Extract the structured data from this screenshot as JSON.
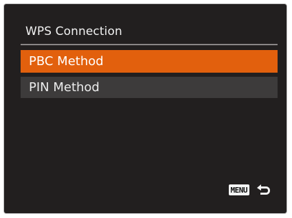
{
  "dialog": {
    "title": "WPS Connection",
    "items": [
      {
        "label": "PBC Method",
        "selected": true
      },
      {
        "label": "PIN Method",
        "selected": false
      }
    ]
  },
  "footer": {
    "menu_button_label": "MENU",
    "return_icon": "return-arrow-icon"
  },
  "colors": {
    "background": "#221f1f",
    "selection": "#e2600d",
    "item_background": "#3d3b3b",
    "divider": "#8a8686"
  }
}
